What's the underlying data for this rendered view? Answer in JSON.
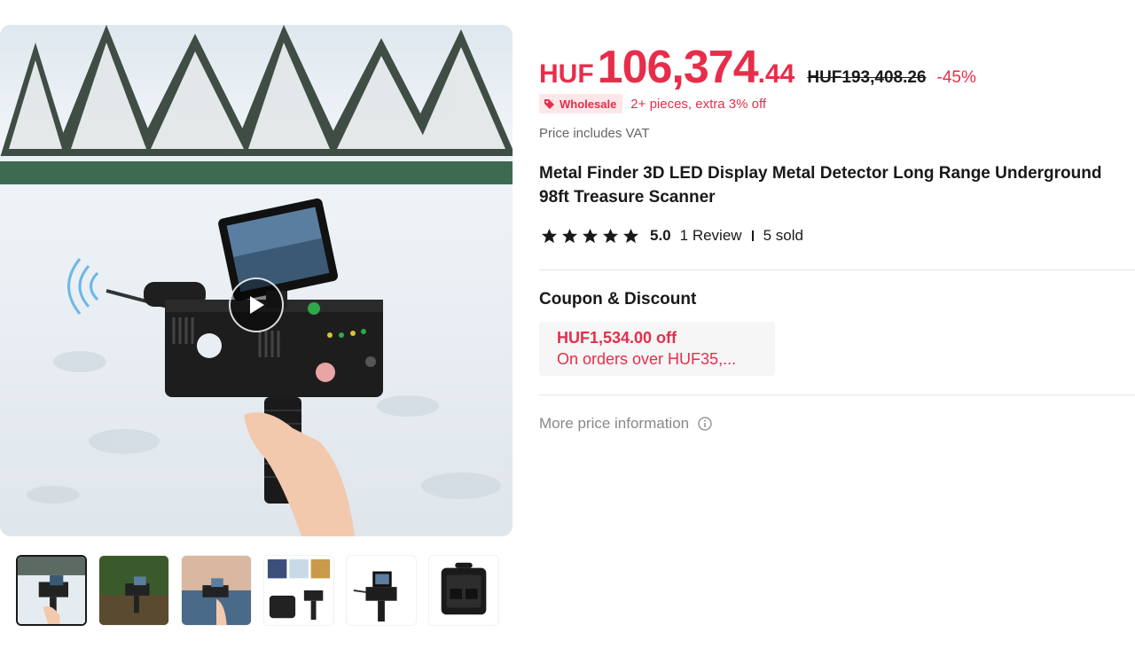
{
  "gallery": {
    "main_image_alt": "Metal detector in snow",
    "play_icon": "play-icon",
    "thumbnails": [
      {
        "name": "thumbnail-snow",
        "active": true
      },
      {
        "name": "thumbnail-field",
        "active": false
      },
      {
        "name": "thumbnail-water",
        "active": false
      },
      {
        "name": "thumbnail-accessories",
        "active": false
      },
      {
        "name": "thumbnail-device",
        "active": false
      },
      {
        "name": "thumbnail-case",
        "active": false
      }
    ]
  },
  "price": {
    "currency": "HUF",
    "main": "106,374",
    "cents": ".44",
    "original": "HUF193,408.26",
    "discount": "-45%"
  },
  "wholesale": {
    "badge": "Wholesale",
    "text": "2+ pieces, extra 3% off",
    "icon": "tag-icon"
  },
  "vat_note": "Price includes VAT",
  "product": {
    "title": "Metal Finder 3D LED Display Metal Detector Long Range Underground 98ft Treasure Scanner"
  },
  "rating": {
    "stars": 5,
    "score": "5.0",
    "reviews": "1 Review",
    "sold": "5 sold"
  },
  "coupon": {
    "title": "Coupon & Discount",
    "amount": "HUF1,534.00 off",
    "condition": "On orders over HUF35,..."
  },
  "more_price": {
    "label": "More price information",
    "icon": "info-icon"
  },
  "colors": {
    "accent": "#e62e4a",
    "text": "#191919",
    "muted": "#666666"
  }
}
